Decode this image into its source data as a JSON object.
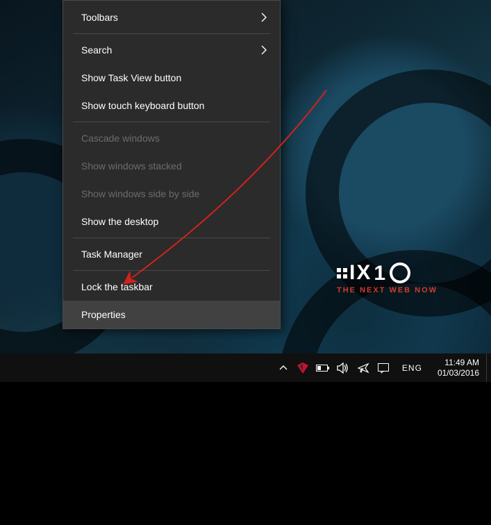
{
  "menu": {
    "toolbars": "Toolbars",
    "search": "Search",
    "show_task_view": "Show Task View button",
    "show_touch_kb": "Show touch keyboard button",
    "cascade": "Cascade windows",
    "stacked": "Show windows stacked",
    "side_by_side": "Show windows side by side",
    "show_desktop": "Show the desktop",
    "task_manager": "Task Manager",
    "lock_taskbar": "Lock the taskbar",
    "properties": "Properties"
  },
  "logo": {
    "brand": "IX",
    "one": "1",
    "tagline": "THE NEXT WEB NOW"
  },
  "tray": {
    "lang": "ENG",
    "time": "11:49 AM",
    "date": "01/03/2016"
  },
  "icons": {
    "chevron_right": "chevron-right-icon",
    "tray_up": "tray-chevron-up-icon",
    "kaspersky": "kaspersky-icon",
    "battery": "battery-icon",
    "volume": "volume-icon",
    "airplane": "airplane-mode-icon",
    "action_center": "action-center-icon"
  },
  "colors": {
    "menu_bg": "#2b2b2b",
    "menu_hover": "#414141",
    "menu_border": "#4a4a4a",
    "disabled_text": "#6c6c6c",
    "arrow": "#d1221b",
    "logo_accent": "#d33a2d",
    "kaspersky": "#c41230"
  }
}
